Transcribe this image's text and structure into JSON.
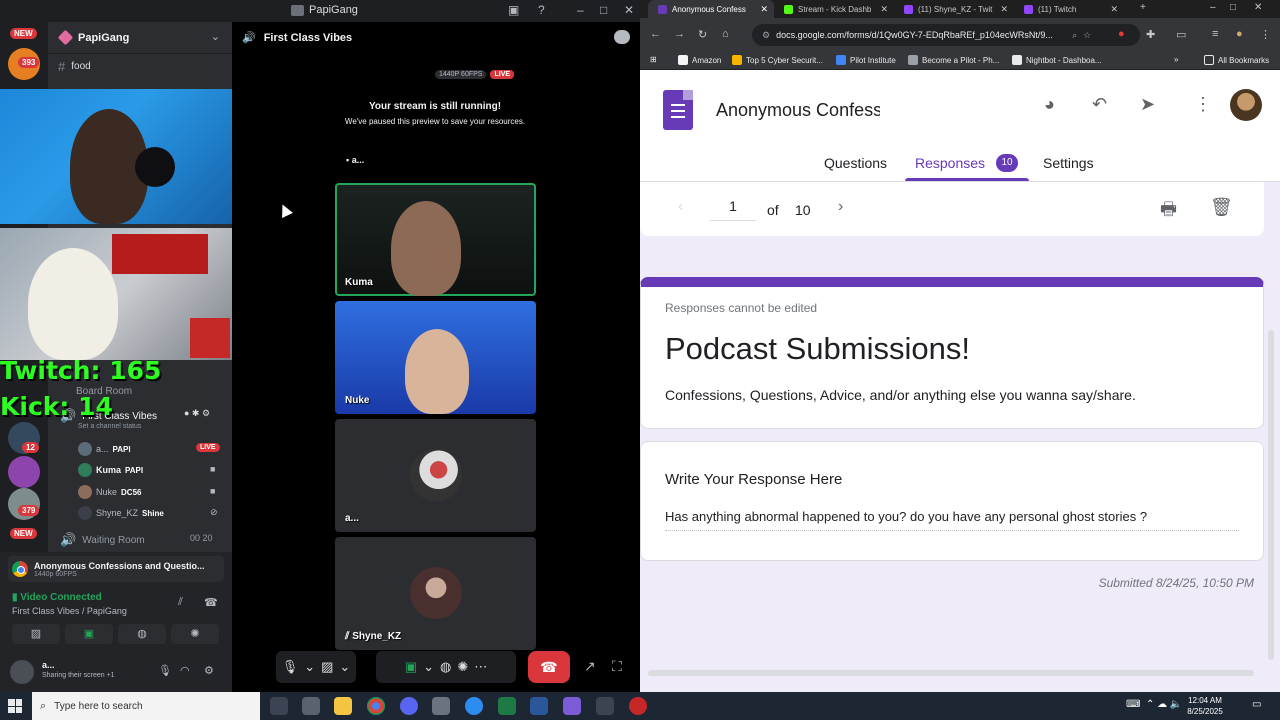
{
  "discord": {
    "window_title": "PapiGang",
    "server_name": "PapiGang",
    "channels": {
      "food": "food",
      "board_room": "Board Room",
      "first_class": "First Class Vibes",
      "channel_status": "Set a channel status",
      "waiting_room": "Waiting Room",
      "waiting_count_a": "00",
      "waiting_count_b": "20"
    },
    "voice_users": [
      {
        "name": "a...",
        "tag": "PAPI",
        "badge": "LIVE"
      },
      {
        "name": "Kuma",
        "tag": "PAPI"
      },
      {
        "name": "Nuke",
        "tag": "DC56"
      },
      {
        "name": "Shyne_KZ",
        "tag": "Shine"
      }
    ],
    "server_badges": [
      "NEW",
      "393",
      "12",
      "379",
      "NEW"
    ],
    "overlay": {
      "twitch": "Twitch: 165",
      "kick": "Kick: 14"
    },
    "stage": {
      "channel_title": "First Class Vibes",
      "quality": "1440P 60FPS",
      "live": "LIVE",
      "paused_title": "Your stream is still running!",
      "paused_body": "We've paused this preview to save your resources.",
      "stream_owner": "a...",
      "tiles": [
        {
          "label": "Kuma"
        },
        {
          "label": "Nuke"
        },
        {
          "label": "a..."
        },
        {
          "label": "Shyne_KZ"
        }
      ]
    },
    "rtc": {
      "stream_title": "Anonymous Confessions and Questio...",
      "stream_sub": "1440p 60FPS",
      "connected": "Video Connected",
      "location": "First Class Vibes / PapiGang"
    },
    "me": {
      "name": "a...",
      "status": "Sharing their screen +1"
    }
  },
  "chrome": {
    "tabs": [
      {
        "title": "Anonymous Confess",
        "color": "#673ab7",
        "active": true
      },
      {
        "title": "Stream - Kick Dashb",
        "color": "#53fc18"
      },
      {
        "title": "(11) Shyne_KZ - Twit",
        "color": "#9146ff"
      },
      {
        "title": "(11) Twitch",
        "color": "#9146ff"
      }
    ],
    "url": "docs.google.com/forms/d/1Qw0GY-7-EDqRbaREf_p104ecWRsNt/9...",
    "bookmarks": [
      "Amazon",
      "Top 5 Cyber Securit...",
      "Pilot Institute",
      "Become a Pilot - Ph...",
      "Nightbot - Dashboa..."
    ],
    "all_bookmarks": "All Bookmarks"
  },
  "form": {
    "title": "Anonymous Confess",
    "tabs": {
      "questions": "Questions",
      "responses": "Responses",
      "settings": "Settings"
    },
    "response_count": "10",
    "pager": {
      "current": "1",
      "of": "of",
      "total": "10"
    },
    "note": "Responses cannot be edited",
    "heading": "Podcast Submissions!",
    "description": "Confessions, Questions, Advice, and/or anything else you wanna say/share.",
    "question": "Write Your Response Here",
    "answer": "Has anything abnormal happened to you? do you have any personal ghost stories ?",
    "submitted": "Submitted 8/24/25, 10:50 PM"
  },
  "taskbar": {
    "search_placeholder": "Type here to search",
    "time": "12:04 AM",
    "date": "8/25/2025"
  },
  "colors": {
    "forms_purple": "#673ab7",
    "discord_red": "#da373c",
    "overlay_green": "#2dff20",
    "connected_green": "#23a55a"
  }
}
